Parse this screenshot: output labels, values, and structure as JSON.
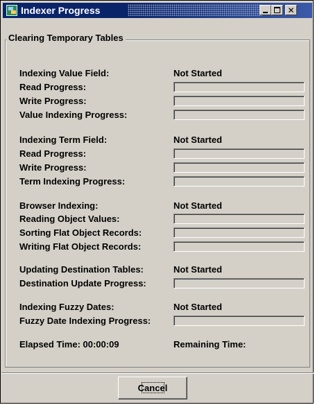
{
  "window": {
    "title": "Indexer Progress",
    "app_icon": "indexer-app-icon",
    "controls": [
      "minimize",
      "maximize",
      "close"
    ]
  },
  "group": {
    "title": "Clearing Temporary Tables"
  },
  "sections": {
    "value_field": {
      "label": "Indexing Value Field:",
      "status": "Not Started",
      "read_label": "Read Progress:",
      "read_progress": 0,
      "write_label": "Write Progress:",
      "write_progress": 0,
      "indexing_label": "Value Indexing Progress:",
      "indexing_progress": 0
    },
    "term_field": {
      "label": "Indexing Term Field:",
      "status": "Not Started",
      "read_label": "Read Progress:",
      "read_progress": 0,
      "write_label": "Write Progress:",
      "write_progress": 0,
      "indexing_label": "Term Indexing Progress:",
      "indexing_progress": 0
    },
    "browser": {
      "label": "Browser Indexing:",
      "status": "Not Started",
      "reading_label": "Reading Object Values:",
      "reading_progress": 0,
      "sorting_label": "Sorting Flat Object Records:",
      "sorting_progress": 0,
      "writing_label": "Writing Flat Object Records:",
      "writing_progress": 0
    },
    "destination": {
      "label": "Updating Destination Tables:",
      "status": "Not Started",
      "update_label": "Destination Update Progress:",
      "update_progress": 0
    },
    "fuzzy": {
      "label": "Indexing Fuzzy Dates:",
      "status": "Not Started",
      "progress_label": "Fuzzy Date Indexing Progress:",
      "progress": 0
    }
  },
  "timing": {
    "elapsed": "Elapsed Time: 00:00:09",
    "remaining": "Remaining Time:"
  },
  "buttons": {
    "cancel": "Cancel"
  }
}
